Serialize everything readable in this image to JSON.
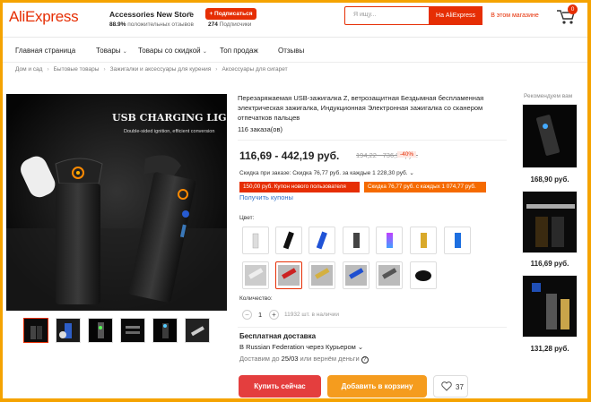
{
  "header": {
    "logo": "AliExpress",
    "store_name": "Accessories New Store",
    "follow_label": "+ Подписаться",
    "rating_value": "88.9%",
    "rating_text": " положительных отзывов",
    "followers_count": "274",
    "followers_text": " Подписчики",
    "search_placeholder": "Я ищу...",
    "search_ali_label": "На AliExpress",
    "search_store_label": "В этом магазине",
    "cart_count": "0"
  },
  "nav": {
    "items": [
      "Главная страница",
      "Товары",
      "Товары со скидкой",
      "Топ продаж",
      "Отзывы"
    ]
  },
  "breadcrumb": [
    "Дом и сад",
    "Бытовые товары",
    "Зажигалки и аксессуары для курения",
    "Аксессуары для сигарет"
  ],
  "gallery": {
    "banner_title": "USB CHARGING LIGHTER",
    "banner_subtitle": "Double-sided ignition, efficient conversion"
  },
  "product": {
    "title": "Перезаряжаемая USB-зажигалка Z, ветрозащитная Бездымная беспламенная электрическая зажигалка, Индукционная Электронная зажигалка со сканером отпечатков пальцев",
    "orders": "116 заказа(ов)",
    "price": "116,69 - 442,19 руб.",
    "old_price": "194,22 - 736,98 руб.",
    "discount": "-40%",
    "discount_line": "Скидка при заказе: Скидка 76,77 руб. за каждые 1 228,30 руб.",
    "coupon_1": "150,00 руб. Купон нового пользователя",
    "coupon_2": "Скидка 76,77 руб. с каждых 1 074,77 руб.",
    "get_coupons": "Получить купоны",
    "color_label": "Цвет:",
    "quantity_label": "Количество:",
    "quantity_value": "1",
    "quantity_available": "11932 шт. в наличии",
    "shipping_title": "Бесплатная доставка",
    "shipping_via": "В Russian Federation через Курьером",
    "shipping_date_prefix": "Доставим до ",
    "shipping_date": "25/03",
    "shipping_date_suffix": " или вернём деньги",
    "buy_now": "Купить сейчас",
    "add_to_cart": "Добавить в корзину",
    "wishlist_count": "37"
  },
  "recommend": {
    "title": "Рекомендуем вам",
    "prices": [
      "168,90 руб.",
      "116,69 руб.",
      "131,28 руб."
    ]
  },
  "colors": {
    "brand": "#e62e04",
    "buy": "#e43e3e",
    "cart": "#f59c1e",
    "frame": "#f5a300",
    "link": "#2f70c7"
  }
}
